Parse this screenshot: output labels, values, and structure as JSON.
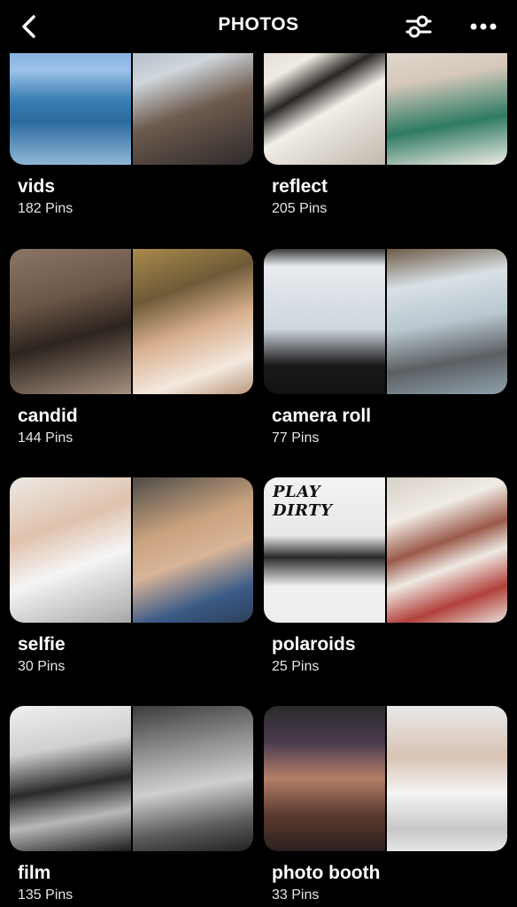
{
  "header": {
    "title": "PHOTOS",
    "back_icon": "chevron-left-icon",
    "filter_icon": "sliders-icon",
    "more_icon": "ellipsis-icon"
  },
  "boards": [
    {
      "name": "vids",
      "count": "182 Pins"
    },
    {
      "name": "reflect",
      "count": "205 Pins"
    },
    {
      "name": "candid",
      "count": "144 Pins"
    },
    {
      "name": "camera roll",
      "count": "77 Pins"
    },
    {
      "name": "selfie",
      "count": "30 Pins"
    },
    {
      "name": "polaroids",
      "count": "25 Pins"
    },
    {
      "name": "film",
      "count": "135 Pins"
    },
    {
      "name": "photo booth",
      "count": "33 Pins"
    }
  ],
  "thumb_text": {
    "play_dirty": "PLAY DIRTY"
  }
}
